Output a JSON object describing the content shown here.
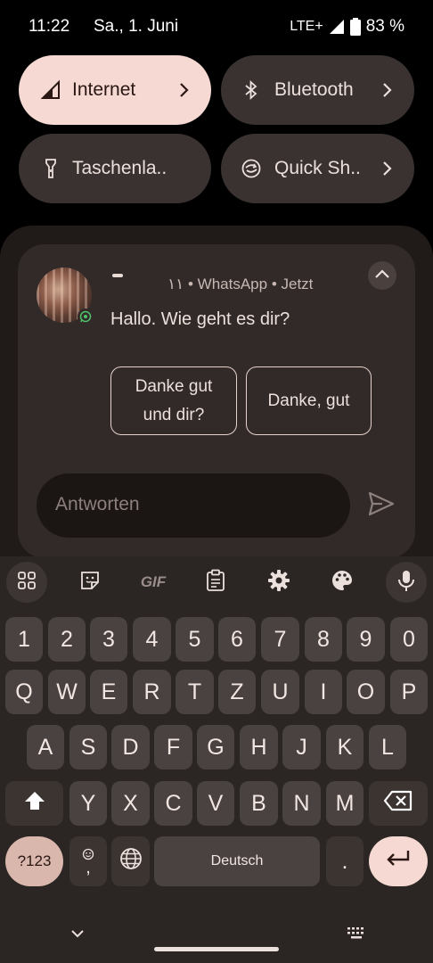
{
  "status_bar": {
    "time": "11:22",
    "date": "Sa., 1. Juni",
    "network": "LTE+",
    "battery": "83 %"
  },
  "quick_settings": {
    "tiles": [
      {
        "label": "Internet",
        "icon": "signal-icon",
        "active": true
      },
      {
        "label": "Bluetooth",
        "icon": "bluetooth-icon",
        "active": false
      },
      {
        "label": "Taschenla..",
        "icon": "flashlight-icon",
        "active": false
      },
      {
        "label": "Quick Sh..",
        "icon": "quick-share-icon",
        "active": false
      }
    ]
  },
  "notification": {
    "meta": "١١ • WhatsApp • Jetzt",
    "message": "Hallo. Wie geht es dir?",
    "smart_replies": [
      "Danke gut und dir?",
      "Danke, gut"
    ],
    "reply_placeholder": "Antworten"
  },
  "keyboard": {
    "toolbar": [
      "apps-grid-icon",
      "sticker-icon",
      "gif-icon",
      "clipboard-icon",
      "settings-icon",
      "palette-icon",
      "mic-icon"
    ],
    "gif_label": "GIF",
    "rows": [
      [
        "1",
        "2",
        "3",
        "4",
        "5",
        "6",
        "7",
        "8",
        "9",
        "0"
      ],
      [
        "Q",
        "W",
        "E",
        "R",
        "T",
        "Z",
        "U",
        "I",
        "O",
        "P"
      ],
      [
        "A",
        "S",
        "D",
        "F",
        "G",
        "H",
        "J",
        "K",
        "L"
      ],
      [
        "Y",
        "X",
        "C",
        "V",
        "B",
        "N",
        "M"
      ]
    ],
    "symbols_label": "?123",
    "emoji_comma_label": ",",
    "space_label": "Deutsch",
    "period_label": "."
  },
  "colors": {
    "accent_tile": "#f5d9d2",
    "panel": "#201a18",
    "card": "#322a28",
    "key": "#4a4240",
    "keyboard_bg": "#2b2624"
  }
}
